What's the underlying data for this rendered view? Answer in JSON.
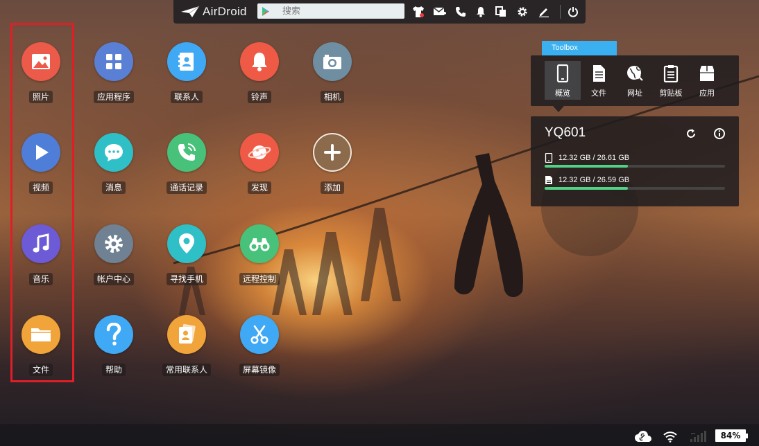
{
  "topbar": {
    "logo_text": "AirDroid",
    "search_placeholder": "搜索",
    "icons": [
      "tshirt-icon",
      "mail-icon",
      "phone-icon",
      "bell-icon",
      "copy-icon",
      "gear-icon",
      "edit-icon",
      "power-icon"
    ]
  },
  "apps": [
    {
      "label": "照片",
      "icon": "image-icon",
      "color": "#ec5a4a"
    },
    {
      "label": "应用程序",
      "icon": "apps-grid-icon",
      "color": "#5a80d6"
    },
    {
      "label": "联系人",
      "icon": "contacts-icon",
      "color": "#3fa9f5"
    },
    {
      "label": "铃声",
      "icon": "bell-icon",
      "color": "#ee5a45"
    },
    {
      "label": "相机",
      "icon": "camera-icon",
      "color": "#6f8ea2"
    },
    {
      "label": "视频",
      "icon": "play-icon",
      "color": "#4f7ed8"
    },
    {
      "label": "消息",
      "icon": "chat-icon",
      "color": "#2fbfc7"
    },
    {
      "label": "通话记录",
      "icon": "phone-icon",
      "color": "#48c17a"
    },
    {
      "label": "发现",
      "icon": "planet-icon",
      "color": "#ee5a45"
    },
    {
      "label": "添加",
      "icon": "plus-icon",
      "color": "#8c6b4d"
    },
    {
      "label": "音乐",
      "icon": "music-icon",
      "color": "#6d5ad6"
    },
    {
      "label": "帐户中心",
      "icon": "gear-icon",
      "color": "#6f8192"
    },
    {
      "label": "寻找手机",
      "icon": "location-pin-icon",
      "color": "#2fbfc7"
    },
    {
      "label": "远程控制",
      "icon": "binoculars-icon",
      "color": "#48c17a"
    },
    {
      "label": "文件",
      "icon": "folder-icon",
      "color": "#f0a43a"
    },
    {
      "label": "帮助",
      "icon": "question-icon",
      "color": "#3fa9f5"
    },
    {
      "label": "常用联系人",
      "icon": "contact-card-icon",
      "color": "#f0a43a"
    },
    {
      "label": "屏幕镜像",
      "icon": "scissors-icon",
      "color": "#3fa9f5"
    }
  ],
  "toolbox": {
    "title": "Toolbox",
    "tools": [
      {
        "label": "概览",
        "icon": "phone-device-icon",
        "active": true
      },
      {
        "label": "文件",
        "icon": "file-icon",
        "active": false
      },
      {
        "label": "网址",
        "icon": "globe-icon",
        "active": false
      },
      {
        "label": "剪贴板",
        "icon": "clipboard-icon",
        "active": false
      },
      {
        "label": "应用",
        "icon": "app-box-icon",
        "active": false
      }
    ]
  },
  "device": {
    "name": "YQ601",
    "storage": [
      {
        "icon": "phone-storage-icon",
        "text": "12.32 GB / 26.61 GB",
        "used": 12.32,
        "total": 26.61
      },
      {
        "icon": "sd-card-icon",
        "text": "12.32 GB / 26.59 GB",
        "used": 12.32,
        "total": 26.59
      }
    ]
  },
  "status": {
    "battery": "84%",
    "icons": [
      "cloud-link-icon",
      "wifi-icon",
      "signal-icon"
    ]
  },
  "colors": {
    "highlight": "#e01e26",
    "toolbox_tab": "#3bb0f0",
    "storage_bar": "#51d285"
  }
}
